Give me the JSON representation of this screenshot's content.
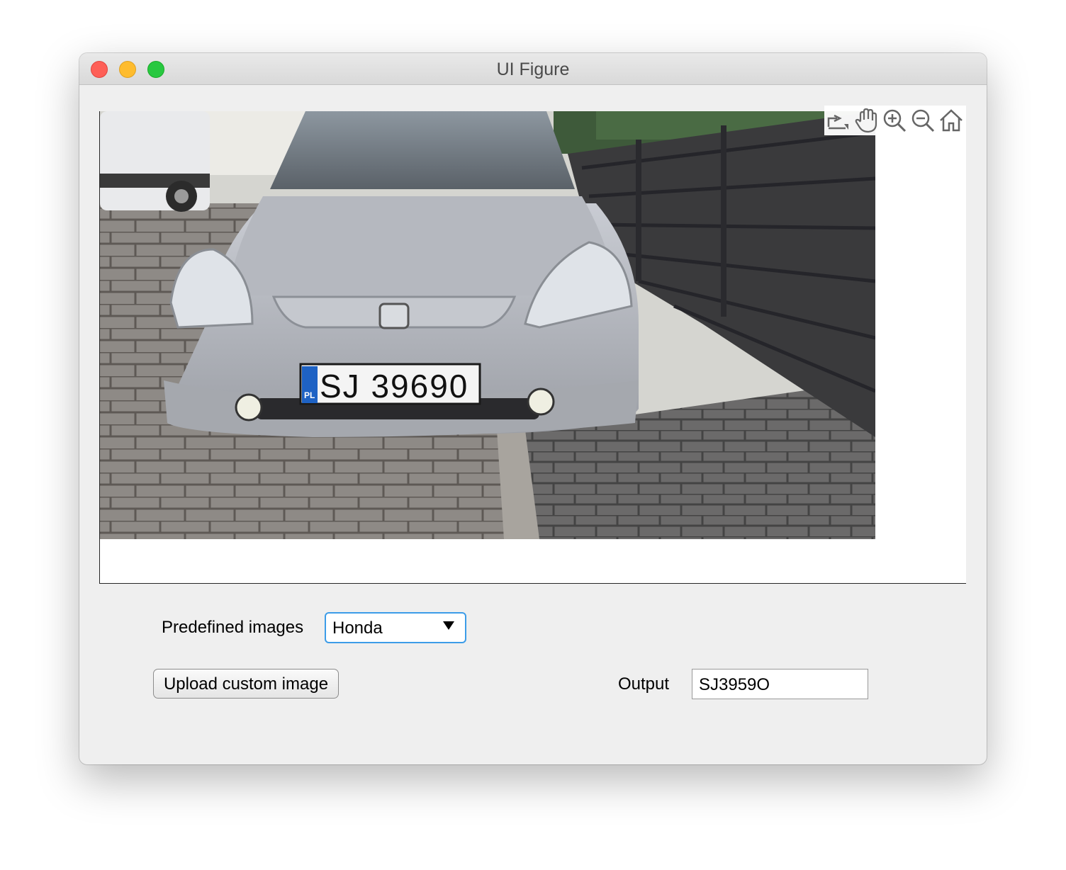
{
  "window": {
    "title": "UI Figure"
  },
  "axes": {
    "image_subject": "silver Honda car with license plate SJ 39690",
    "plate_text": "SJ 39690",
    "plate_country": "PL",
    "toolbar": [
      "export-icon",
      "pan-icon",
      "zoom-in-icon",
      "zoom-out-icon",
      "home-icon"
    ]
  },
  "controls": {
    "predefined_label": "Predefined images",
    "predefined_selected": "Honda",
    "upload_button": "Upload custom image",
    "output_label": "Output",
    "output_value": "SJ3959O"
  },
  "colors": {
    "accent": "#3c9ce8",
    "close": "#fe5f57",
    "minimize": "#febc2e",
    "maximize": "#28c840"
  }
}
